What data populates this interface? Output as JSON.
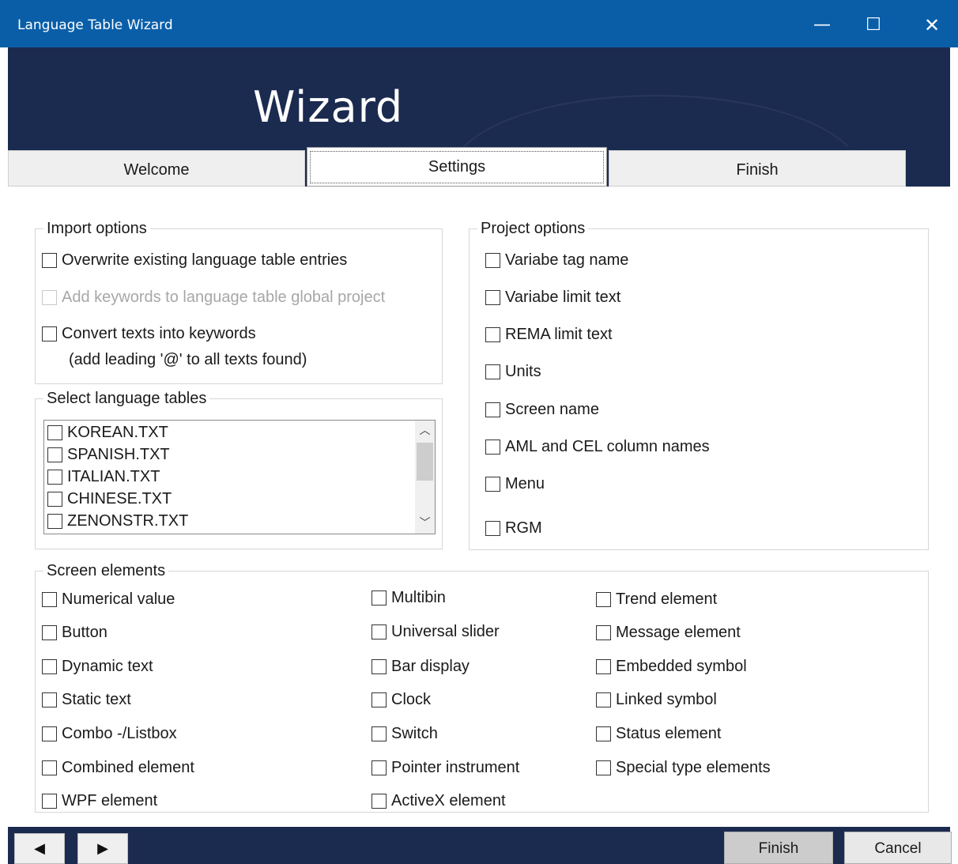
{
  "window": {
    "title": "Language Table Wizard",
    "minimize": "—",
    "maximize": "☐",
    "close": "✕"
  },
  "banner": {
    "heading": "Wizard"
  },
  "tabs": [
    "Welcome",
    "Settings",
    "Finish"
  ],
  "import_options": {
    "legend": "Import options",
    "overwrite": "Overwrite existing language table entries",
    "add_keywords": "Add keywords  to language table global project",
    "convert": "Convert  texts  into  keywords",
    "convert_note": "(add leading '@' to all texts found)"
  },
  "language_tables": {
    "legend": "Select language tables",
    "items": [
      "KOREAN.TXT",
      "SPANISH.TXT",
      "ITALIAN.TXT",
      "CHINESE.TXT",
      "ZENONSTR.TXT"
    ]
  },
  "project_options": {
    "legend": "Project options",
    "items": [
      "Variabe tag name",
      "Variabe limit text",
      "REMA limit text",
      "Units",
      "Screen name",
      "AML and CEL column names",
      "Menu",
      "RGM"
    ]
  },
  "screen_elements": {
    "legend": "Screen elements",
    "col1": [
      "Numerical value",
      "Button",
      "Dynamic text",
      "Static text",
      "Combo -/Listbox",
      "Combined element",
      "WPF element"
    ],
    "col2": [
      "Multibin",
      "Universal slider",
      "Bar display",
      "Clock",
      "Switch",
      "Pointer instrument",
      "ActiveX element"
    ],
    "col3": [
      "Trend element",
      "Message element",
      "Embedded symbol",
      "Linked symbol",
      "Status element",
      "Special type elements"
    ]
  },
  "footer": {
    "prev": "◀",
    "next": "▶",
    "finish": "Finish",
    "cancel": "Cancel"
  }
}
